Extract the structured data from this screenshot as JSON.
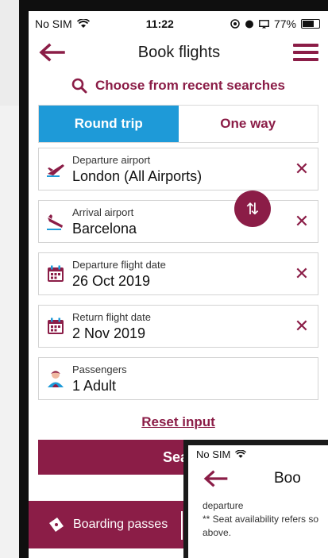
{
  "status": {
    "carrier": "No SIM",
    "time": "11:22",
    "battery": "77%"
  },
  "header": {
    "title": "Book flights"
  },
  "recent_searches": {
    "label": "Choose from recent searches"
  },
  "tabs": [
    {
      "label": "Round trip",
      "active": true
    },
    {
      "label": "One way",
      "active": false
    }
  ],
  "fields": {
    "departure": {
      "label": "Departure airport",
      "value": "London (All Airports)"
    },
    "arrival": {
      "label": "Arrival airport",
      "value": "Barcelona"
    },
    "departure_date": {
      "label": "Departure flight date",
      "value": "26 Oct 2019"
    },
    "return_date": {
      "label": "Return flight date",
      "value": "2 Nov 2019"
    },
    "passengers": {
      "label": "Passengers",
      "value": "1 Adult"
    }
  },
  "reset": {
    "label": "Reset input"
  },
  "search": {
    "label": "Sear"
  },
  "bottom": {
    "boarding_label": "Boarding passes"
  },
  "overlay": {
    "carrier": "No SIM",
    "title": "Boo",
    "lines": [
      "departure",
      "** Seat availability refers so",
      "above."
    ]
  },
  "colors": {
    "accent": "#8b1d47",
    "tab_active": "#1e9ad8"
  }
}
